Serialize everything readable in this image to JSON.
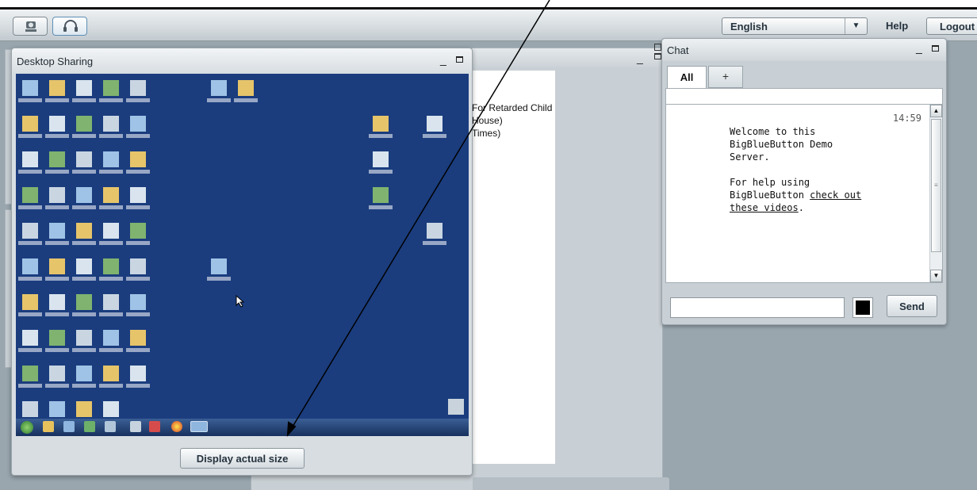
{
  "toolbar": {
    "icons": [
      "webcam-icon",
      "headset-icon"
    ],
    "language": "English",
    "help_label": "Help",
    "logout_label": "Logout"
  },
  "desktop_sharing": {
    "title": "Desktop Sharing",
    "display_actual_size_label": "Display actual size"
  },
  "presentation": {
    "slide_lines": [
      "For Retarded Child",
      "House)",
      "Times)"
    ]
  },
  "chat": {
    "title": "Chat",
    "tabs": [
      {
        "label": "All"
      },
      {
        "label": "+"
      }
    ],
    "message": {
      "time": "14:59",
      "line1": "Welcome to this",
      "line2": "BigBlueButton Demo",
      "line3": "Server.",
      "line4": "For help using",
      "line5_prefix": "BigBlueButton ",
      "link_part1": "check out",
      "link_part2": "these videos",
      "line6_suffix": "."
    },
    "input_placeholder": "",
    "send_label": "Send",
    "text_color": "#000000"
  },
  "colors": {
    "desktop_background": "#1b3d7e",
    "app_background": "#99a6ae"
  }
}
